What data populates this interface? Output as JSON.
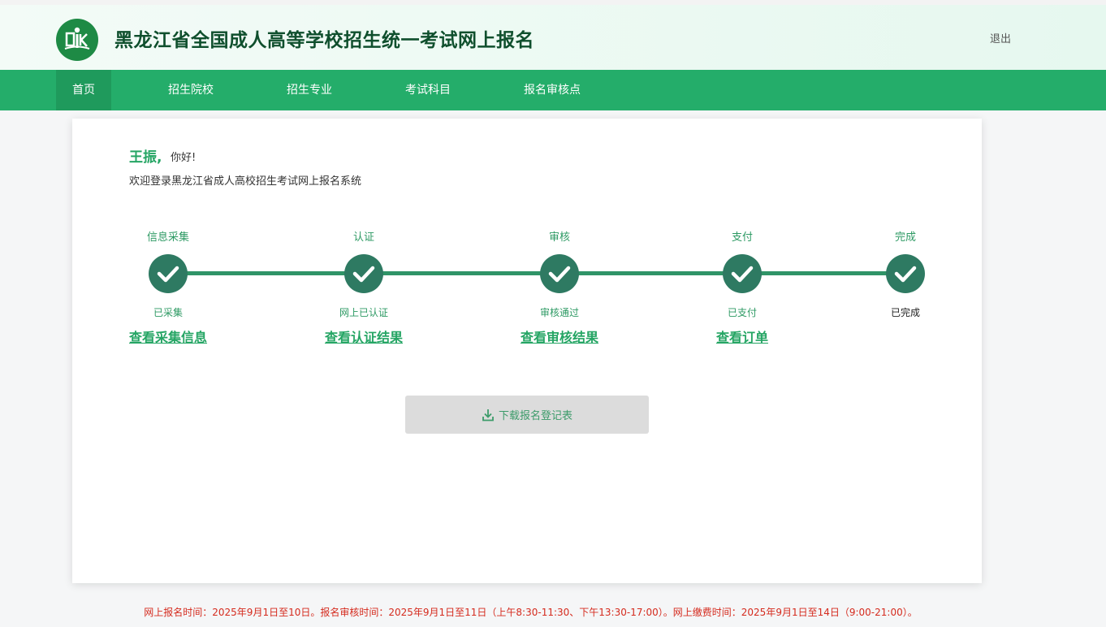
{
  "header": {
    "title": "黑龙江省全国成人高等学校招生统一考试网上报名",
    "logout_label": "退出",
    "logo_icon": "book-reader-logo"
  },
  "nav": {
    "items": [
      {
        "label": "首页",
        "active": true
      },
      {
        "label": "招生院校",
        "active": false
      },
      {
        "label": "招生专业",
        "active": false
      },
      {
        "label": "考试科目",
        "active": false
      },
      {
        "label": "报名审核点",
        "active": false
      }
    ]
  },
  "greeting": {
    "name": "王振,",
    "hello": "你好!",
    "welcome": "欢迎登录黑龙江省成人高校招生考试网上报名系统"
  },
  "steps": [
    {
      "title": "信息采集",
      "status": "已采集",
      "link": "查看采集信息",
      "icon": "check-icon"
    },
    {
      "title": "认证",
      "status": "网上已认证",
      "link": "查看认证结果",
      "icon": "check-icon"
    },
    {
      "title": "审核",
      "status": "审核通过",
      "link": "查看审核结果",
      "icon": "check-icon"
    },
    {
      "title": "支付",
      "status": "已支付",
      "link": "查看订单",
      "icon": "check-icon"
    },
    {
      "title": "完成",
      "status": "已完成",
      "link": "",
      "icon": "check-icon"
    }
  ],
  "download": {
    "label": "下载报名登记表",
    "icon": "download-icon"
  },
  "notice": "网上报名时间：2025年9月1日至10日。报名审核时间：2025年9月1日至11日（上午8:30-11:30、下午13:30-17:00）。网上缴费时间：2025年9月1日至14日（9:00-21:00）。",
  "colors": {
    "nav_bg": "#24ad6a",
    "accent": "#25a564",
    "step_circle": "#2e7a62",
    "notice": "#d52b1e"
  }
}
